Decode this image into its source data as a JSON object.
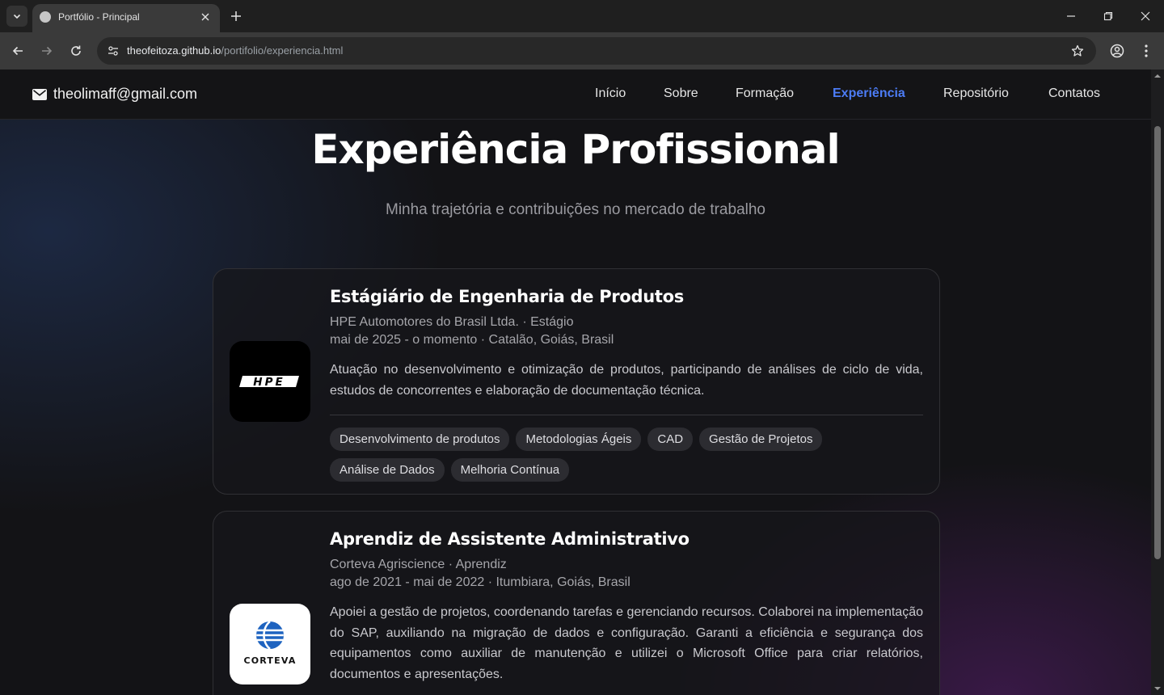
{
  "browser": {
    "tab_title": "Portfólio - Principal",
    "url_host": "theofeitoza.github.io",
    "url_path": "/portifolio/experiencia.html"
  },
  "header": {
    "email": "theolimaff@gmail.com",
    "nav": [
      "Início",
      "Sobre",
      "Formação",
      "Experiência",
      "Repositório",
      "Contatos"
    ],
    "active_nav": "Experiência",
    "active_color": "#4c7cf5"
  },
  "hero": {
    "title": "Experiência Profissional",
    "subtitle": "Minha trajetória e contribuições no mercado de trabalho"
  },
  "experiences": [
    {
      "logo_text": "HPE",
      "role": "Estágiário de Engenharia de Produtos",
      "company": "HPE Automotores do Brasil Ltda. · Estágio",
      "period": "mai de 2025 - o momento · Catalão, Goiás, Brasil",
      "description": "Atuação no desenvolvimento e otimização de produtos, participando de análises de ciclo de vida, estudos de concorrentes e elaboração de documentação técnica.",
      "skills": [
        "Desenvolvimento de produtos",
        "Metodologias Ágeis",
        "CAD",
        "Gestão de Projetos",
        "Análise de Dados",
        "Melhoria Contínua"
      ]
    },
    {
      "logo_text": "CORTEVA",
      "role": "Aprendiz de Assistente Administrativo",
      "company": "Corteva Agriscience · Aprendiz",
      "period": "ago de 2021 - mai de 2022 · Itumbiara, Goiás, Brasil",
      "description": "Apoiei a gestão de projetos, coordenando tarefas e gerenciando recursos. Colaborei na implementação do SAP, auxiliando na migração de dados e configuração. Garanti a eficiência e segurança dos equipamentos como auxiliar de manutenção e utilizei o Microsoft Office para criar relatórios, documentos e apresentações."
    }
  ]
}
